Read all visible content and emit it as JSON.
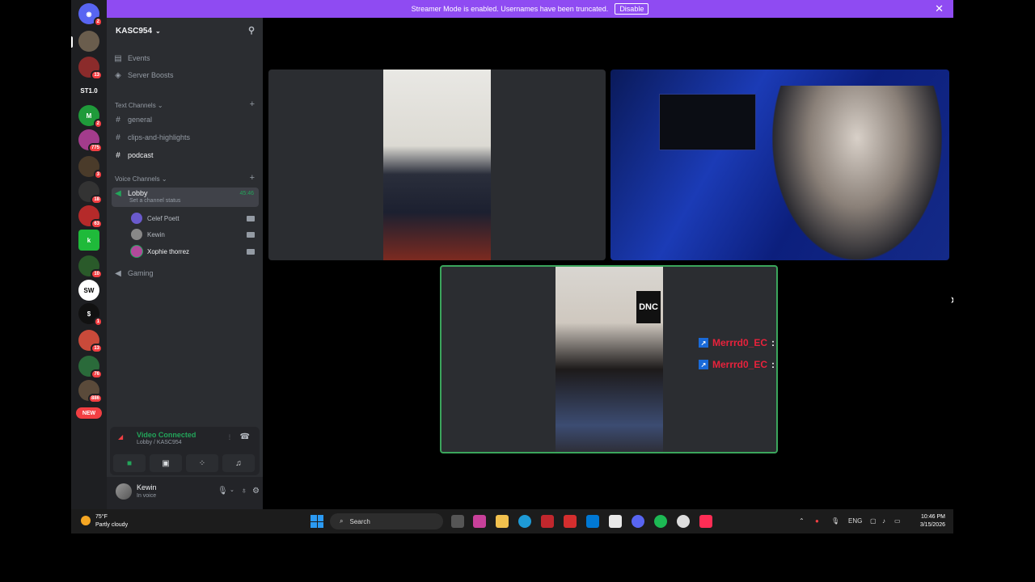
{
  "banner": {
    "text": "Streamer Mode is enabled. Usernames have been truncated.",
    "button": "Disable"
  },
  "rail": {
    "badges": [
      "2",
      "13",
      "2",
      "775",
      "3",
      "18",
      "63",
      "10",
      "1",
      "13",
      "76",
      "886"
    ],
    "st_label": "ST1.0",
    "new_label": "NEW"
  },
  "server": {
    "name": "KASC954"
  },
  "sidebar": {
    "events": "Events",
    "boosts": "Server Boosts",
    "text_category": "Text Channels",
    "text_channels": [
      "general",
      "clips-and-highlights",
      "podcast"
    ],
    "voice_category": "Voice Channels",
    "lobby": {
      "name": "Lobby",
      "timer": "45:46",
      "status": "Set a channel status"
    },
    "voice_users": [
      "Celef Poett",
      "Kewin",
      "Xophie thorrez"
    ],
    "gaming": "Gaming"
  },
  "voice_panel": {
    "title": "Video Connected",
    "subtitle": "Lobby / KASC954"
  },
  "user": {
    "name": "Kewin",
    "status": "In voice"
  },
  "stage": {
    "chat": [
      {
        "user": "Merrrd0_EC"
      },
      {
        "user": "Merrrd0_EC"
      }
    ],
    "sign_text": "DNC"
  },
  "taskbar": {
    "temp": "75°F",
    "weather": "Partly cloudy",
    "search": "Search",
    "lang": "ENG",
    "time": "10:46 PM",
    "date": "3/15/2026"
  },
  "colors": {
    "accent": "#8f4bf2",
    "online": "#23a55a",
    "badge": "#f23f43"
  }
}
